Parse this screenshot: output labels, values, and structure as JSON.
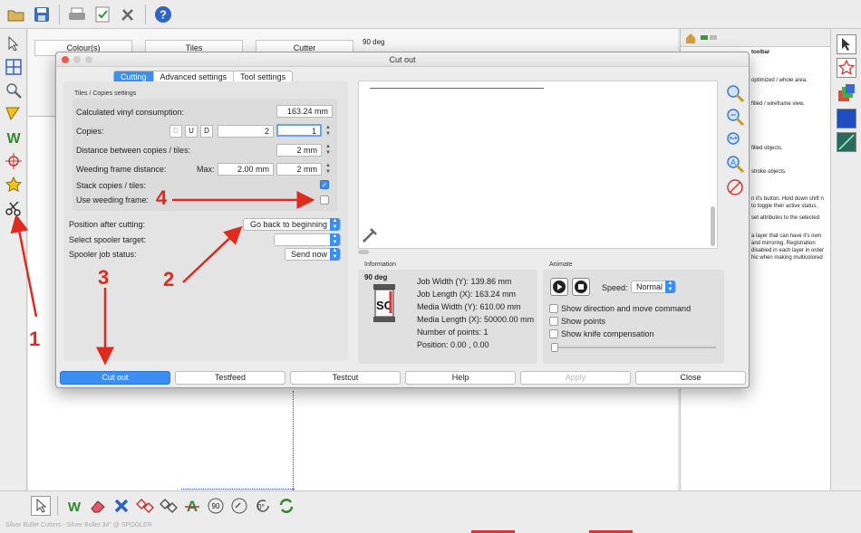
{
  "app": {
    "status_bar": "Silver Bullet Cutters - Silver Bullet 34\" @ SPOOLER",
    "layer_tabs": [
      "Colour(s)",
      "Tiles",
      "Cutter"
    ],
    "deg_label": "90 deg",
    "help_text": [
      "optimized / whole area.",
      "filled / wireframe view.",
      "filled objects.",
      "stroke objects.",
      "n it's button. Hold down shift n to toggle their active status.",
      "set attributes to the selected",
      "a layer that can have it's own and mirroring. Registration disabled in each layer in order hic when making multicolored"
    ],
    "help_title": "toolbar"
  },
  "dialog": {
    "title": "Cut out",
    "tabs": [
      "Cutting",
      "Advanced settings",
      "Tool settings"
    ],
    "active_tab": "Cutting",
    "group_label": "Tiles / Copies settings",
    "rows": {
      "vinyl_label": "Calculated vinyl consumption:",
      "vinyl_value": "163.24 mm",
      "copies_label": "Copies:",
      "copies_buttons": [
        "D",
        "U",
        "D"
      ],
      "copies_value": "2",
      "copies_value2": "1",
      "distance_label": "Distance between copies / tiles:",
      "distance_value": "2 mm",
      "weeding_label": "Weeding frame distance:",
      "weeding_max_label": "Max:",
      "weeding_max_value": "2.00 mm",
      "weeding_value": "2 mm",
      "stack_label": "Stack copies / tiles:",
      "use_weeding_label": "Use weeding frame:"
    },
    "position_label": "Position after cutting:",
    "position_value": "Go back to beginning",
    "spooler_target_label": "Select spooler target:",
    "spooler_target_value": "",
    "spooler_status_label": "Spooler job status:",
    "spooler_status_value": "Send now",
    "information": {
      "head": "Information",
      "deg": "90 deg",
      "lines": [
        "Job Width (Y): 139.86 mm",
        "Job Length (X): 163.24 mm",
        "Media Width (Y): 610.00 mm",
        "Media Length (X): 50000.00 mm",
        "Number of points: 1",
        "Position: 0.00 , 0.00"
      ]
    },
    "animate": {
      "head": "Animate",
      "speed_label": "Speed:",
      "speed_value": "Normal",
      "show_direction": "Show direction and move command",
      "show_points": "Show points",
      "show_knife": "Show knife compensation"
    },
    "buttons": {
      "cut_out": "Cut out",
      "testfeed": "Testfeed",
      "testcut": "Testcut",
      "help": "Help",
      "apply": "Apply",
      "close": "Close"
    }
  },
  "annotations": [
    "1",
    "2",
    "3",
    "4"
  ],
  "colors": {
    "accent": "#3b8ff4",
    "annotation": "#e02a1e"
  }
}
